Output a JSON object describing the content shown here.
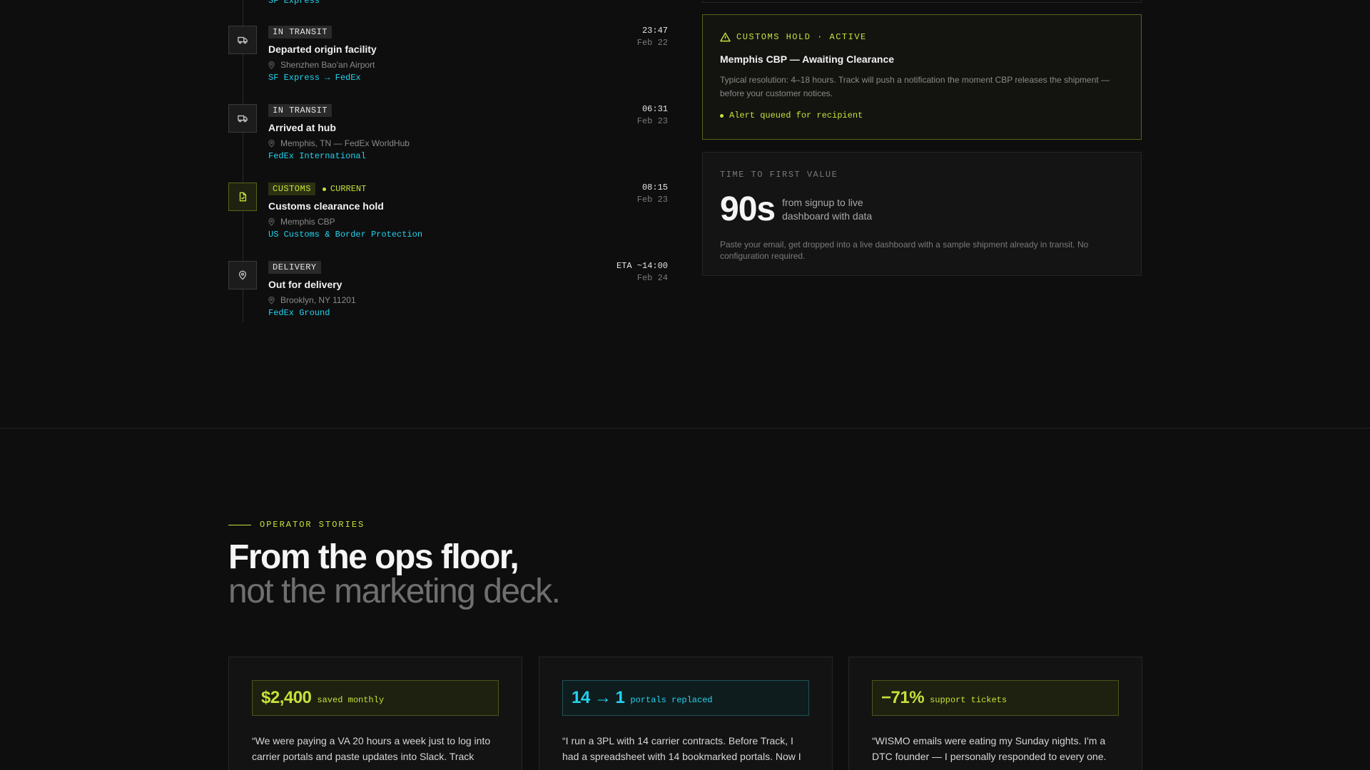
{
  "timeline": {
    "previous_carrier": "SF Express",
    "events": [
      {
        "tag": "IN TRANSIT",
        "title": "Departed origin facility",
        "location": "Shenzhen Bao'an Airport",
        "carrier": "SF Express → FedEx",
        "time": "23:47",
        "date": "Feb 22",
        "icon": "truck-icon"
      },
      {
        "tag": "IN TRANSIT",
        "title": "Arrived at hub",
        "location": "Memphis, TN — FedEx WorldHub",
        "carrier": "FedEx International",
        "time": "06:31",
        "date": "Feb 23",
        "icon": "truck-icon"
      },
      {
        "tag": "CUSTOMS",
        "status": "CURRENT",
        "title": "Customs clearance hold",
        "location": "Memphis CBP",
        "carrier": "US Customs & Border Protection",
        "time": "08:15",
        "date": "Feb 23",
        "icon": "document-check-icon"
      },
      {
        "tag": "DELIVERY",
        "title": "Out for delivery",
        "location": "Brooklyn, NY 11201",
        "carrier": "FedEx Ground",
        "time": "ETA ~14:00",
        "date": "Feb 24",
        "icon": "map-pin-icon"
      }
    ]
  },
  "hold_card": {
    "label": "CUSTOMS HOLD · ACTIVE",
    "title": "Memphis CBP — Awaiting Clearance",
    "description": "Typical resolution: 4–18 hours. Track will push a notification the moment CBP releases the shipment — before your customer notices.",
    "alert": "Alert queued for recipient"
  },
  "ttv_card": {
    "label": "TIME TO FIRST VALUE",
    "value": "90s",
    "caption": "from signup to live dashboard with data",
    "description": "Paste your email, get dropped into a live dashboard with a sample shipment already in transit. No configuration required."
  },
  "stories": {
    "eyebrow": "OPERATOR STORIES",
    "headline_line1": "From the ops floor,",
    "headline_line2": "not the marketing deck.",
    "cards": [
      {
        "stat_value": "$2,400",
        "stat_label": "saved monthly",
        "quote": "“We were paying a VA 20 hours a week just to log into carrier portals and paste updates into Slack. Track"
      },
      {
        "stat_value": "14 → 1",
        "stat_label": "portals replaced",
        "quote": "“I run a 3PL with 14 carrier contracts. Before Track, I had a spreadsheet with 14 bookmarked portals. Now I"
      },
      {
        "stat_value": "−71%",
        "stat_label": "support tickets",
        "quote": "“WISMO emails were eating my Sunday nights. I'm a DTC founder — I personally responded to every one."
      }
    ]
  },
  "colors": {
    "background": "#0e0e0e",
    "accent_lime": "#c8e03a",
    "accent_cyan": "#22d3ee"
  }
}
